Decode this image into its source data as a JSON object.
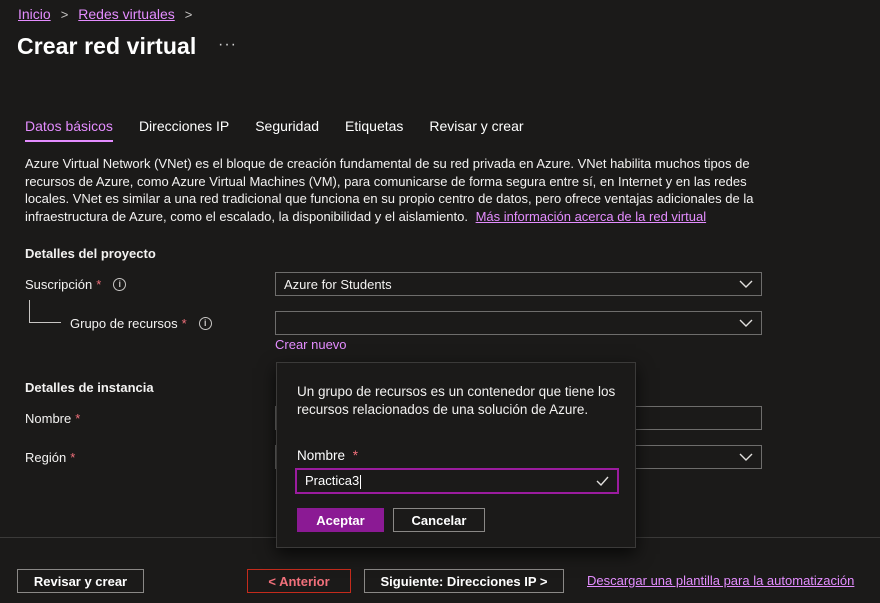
{
  "breadcrumb": {
    "items": [
      "Inicio",
      "Redes virtuales"
    ],
    "separator": ">"
  },
  "page": {
    "title": "Crear red virtual",
    "more": "···"
  },
  "tabs": [
    "Datos básicos",
    "Direcciones IP",
    "Seguridad",
    "Etiquetas",
    "Revisar y crear"
  ],
  "active_tab": "Datos básicos",
  "intro": {
    "text": "Azure Virtual Network (VNet) es el bloque de creación fundamental de su red privada en Azure. VNet habilita muchos tipos de recursos de Azure, como Azure Virtual Machines (VM), para comunicarse de forma segura entre sí, en Internet y en las redes locales. VNet es similar a una red tradicional que funciona en su propio centro de datos, pero ofrece ventajas adicionales de la infraestructura de Azure, como el escalado, la disponibilidad y el aislamiento.",
    "link": "Más información acerca de la red virtual"
  },
  "project": {
    "heading": "Detalles del proyecto",
    "subscription_label": "Suscripción",
    "subscription_value": "Azure for Students",
    "resource_group_label": "Grupo de recursos",
    "resource_group_value": "",
    "create_new": "Crear nuevo"
  },
  "instance": {
    "heading": "Detalles de instancia",
    "name_label": "Nombre",
    "region_label": "Región"
  },
  "required_mark": "*",
  "info_glyph": "i",
  "popup": {
    "description": "Un grupo de recursos es un contenedor que tiene los recursos relacionados de una solución de Azure.",
    "name_label": "Nombre",
    "name_value": "Practica3",
    "accept": "Aceptar",
    "cancel": "Cancelar"
  },
  "footer": {
    "review": "Revisar y crear",
    "previous": "< Anterior",
    "next": "Siguiente: Direcciones IP >",
    "download": "Descargar una plantilla para la automatización"
  },
  "colors": {
    "accent": "#e48dff",
    "primary_button": "#8b1a94",
    "required": "#f1707b",
    "focus_border": "#9b1c9f"
  }
}
